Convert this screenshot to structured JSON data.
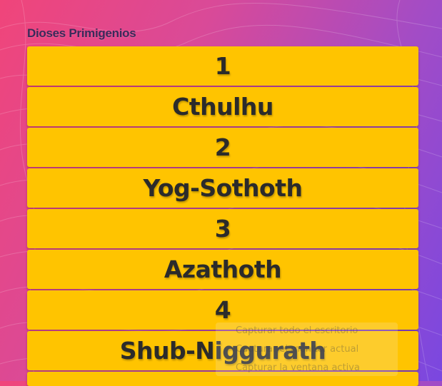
{
  "activity": {
    "title": "Dioses Primigenios"
  },
  "tiles": [
    {
      "label": "1"
    },
    {
      "label": "Cthulhu"
    },
    {
      "label": "2"
    },
    {
      "label": "Yog-Sothoth"
    },
    {
      "label": "3"
    },
    {
      "label": "Azathoth"
    },
    {
      "label": "4"
    },
    {
      "label": "Shub-Niggurath"
    }
  ],
  "context_menu": {
    "items": [
      "Capturar todo el escritorio",
      "Capturar el monitor actual",
      "Capturar la ventana activa"
    ]
  },
  "colors": {
    "tile": "#ffc400",
    "background_start": "#f0457a",
    "background_end": "#7a47e0",
    "title_text": "#3b2a5a"
  }
}
